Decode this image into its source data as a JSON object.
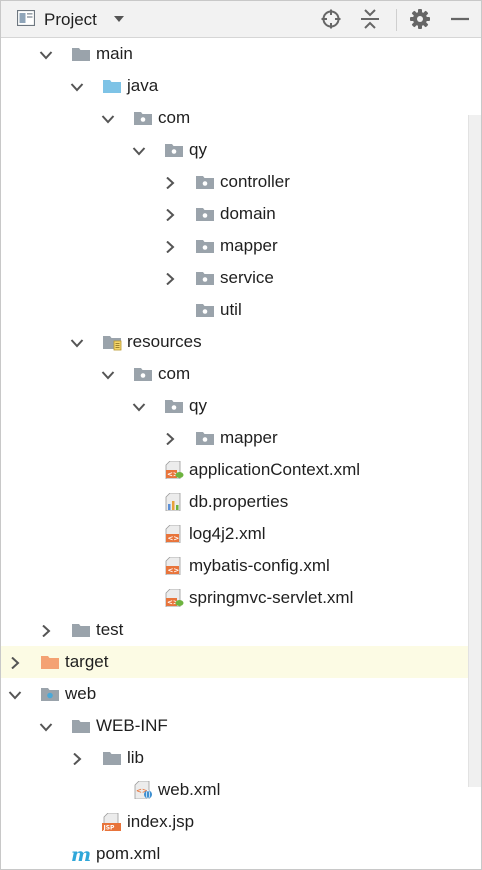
{
  "header": {
    "title": "Project",
    "buttons": [
      {
        "name": "locate-icon"
      },
      {
        "name": "collapse-all-icon"
      },
      {
        "name": "settings-icon"
      },
      {
        "name": "hide-icon"
      }
    ]
  },
  "tree": [
    {
      "label": "main",
      "arrow": "down",
      "icon": "folder",
      "depth": 2
    },
    {
      "label": "java",
      "arrow": "down",
      "icon": "folder-source",
      "depth": 3
    },
    {
      "label": "com",
      "arrow": "down",
      "icon": "package",
      "depth": 4
    },
    {
      "label": "qy",
      "arrow": "down",
      "icon": "package",
      "depth": 5
    },
    {
      "label": "controller",
      "arrow": "right",
      "icon": "package",
      "depth": 6
    },
    {
      "label": "domain",
      "arrow": "right",
      "icon": "package",
      "depth": 6
    },
    {
      "label": "mapper",
      "arrow": "right",
      "icon": "package",
      "depth": 6
    },
    {
      "label": "service",
      "arrow": "right",
      "icon": "package",
      "depth": 6
    },
    {
      "label": "util",
      "arrow": "none",
      "icon": "package",
      "depth": 6
    },
    {
      "label": "resources",
      "arrow": "down",
      "icon": "folder-resources",
      "depth": 3
    },
    {
      "label": "com",
      "arrow": "down",
      "icon": "package",
      "depth": 4
    },
    {
      "label": "qy",
      "arrow": "down",
      "icon": "package",
      "depth": 5
    },
    {
      "label": "mapper",
      "arrow": "right",
      "icon": "package",
      "depth": 6
    },
    {
      "label": "applicationContext.xml",
      "arrow": "none",
      "icon": "spring-xml",
      "depth": 5
    },
    {
      "label": "db.properties",
      "arrow": "none",
      "icon": "properties",
      "depth": 5
    },
    {
      "label": "log4j2.xml",
      "arrow": "none",
      "icon": "xml",
      "depth": 5
    },
    {
      "label": "mybatis-config.xml",
      "arrow": "none",
      "icon": "xml",
      "depth": 5
    },
    {
      "label": "springmvc-servlet.xml",
      "arrow": "none",
      "icon": "spring-xml",
      "depth": 5
    },
    {
      "label": "test",
      "arrow": "right",
      "icon": "folder",
      "depth": 2
    },
    {
      "label": "target",
      "arrow": "right",
      "icon": "folder-excluded",
      "depth": 1,
      "highlight": true
    },
    {
      "label": "web",
      "arrow": "down",
      "icon": "folder-web",
      "depth": 1
    },
    {
      "label": "WEB-INF",
      "arrow": "down",
      "icon": "folder",
      "depth": 2
    },
    {
      "label": "lib",
      "arrow": "right",
      "icon": "folder",
      "depth": 3
    },
    {
      "label": "web.xml",
      "arrow": "none",
      "icon": "web-xml",
      "depth": 4
    },
    {
      "label": "index.jsp",
      "arrow": "none",
      "icon": "jsp",
      "depth": 3
    },
    {
      "label": "pom.xml",
      "arrow": "none",
      "icon": "maven",
      "depth": 2
    }
  ],
  "colors": {
    "folder": "#9aa3ab",
    "source_folder": "#7ec3e6",
    "excluded_folder": "#f4a273",
    "highlight_row": "#fcfbe4",
    "maven": "#2fa7d9"
  }
}
